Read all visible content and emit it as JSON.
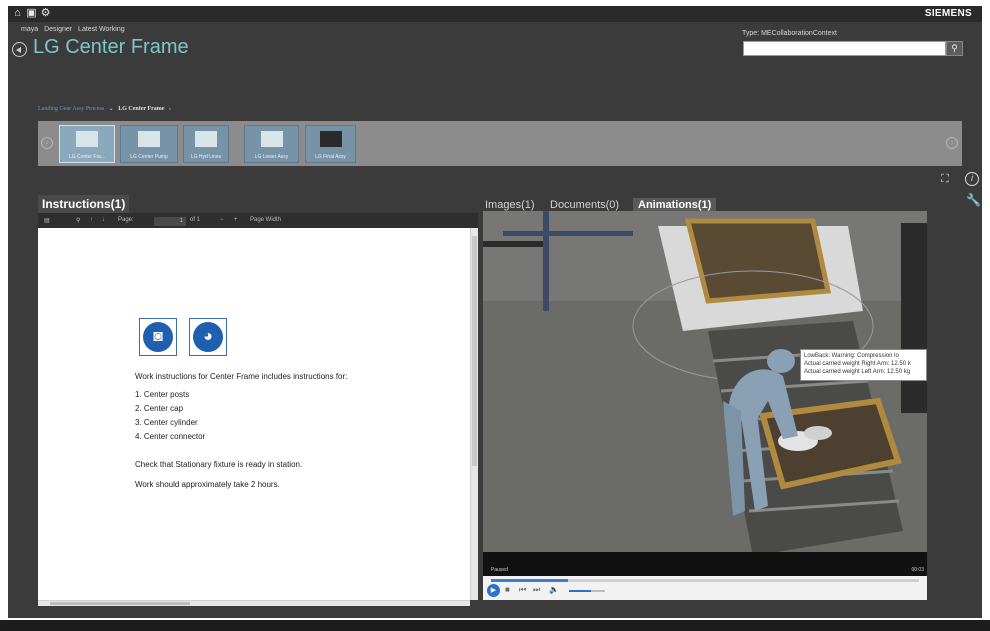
{
  "topbar": {
    "icons": [
      "home-icon",
      "export-icon",
      "settings-icon"
    ],
    "brand": "SIEMENS"
  },
  "header": {
    "crumbs": [
      "maya",
      "Designer",
      "Latest Working"
    ],
    "title": "LG Center Frame",
    "type_label": "Type: MECollaborationContext",
    "search_value": ""
  },
  "process": {
    "parent": "Landing Gear Assy Process",
    "current": "LG Center Frame"
  },
  "carousel": {
    "items": [
      {
        "label": "LG Center Fra...",
        "active": true
      },
      {
        "label": "LG Center Pump",
        "active": false
      },
      {
        "label": "LG Hyd Lines",
        "active": false
      },
      {
        "label": "LG Lower Assy",
        "active": false
      },
      {
        "label": "LG Final Assy",
        "active": false
      }
    ]
  },
  "instructions": {
    "title": "Instructions(1)",
    "toolbar": {
      "page_label": "Page:",
      "page_value": "1",
      "page_of": "of 1",
      "zoom": "Page Width"
    },
    "heading": "Work instructions for Center Frame includes instructions for:",
    "items": [
      "1.  Center posts",
      "2.  Center cap",
      "3.  Center cylinder",
      "4.  Center connector"
    ],
    "note1": "Check that Stationary fixture is ready in station.",
    "note2": "Work should approximately take 2 hours."
  },
  "media": {
    "tabs": [
      "Images(1)",
      "Documents(0)",
      "Animations(1)"
    ],
    "active_tab": "Animations(1)",
    "tooltip": [
      "LowBack:  Warning: Compression lo",
      "Actual carried weight Right Arm: 12.50 k",
      "Actual carried weight Left Arm: 12.50 kg"
    ],
    "status": "Paused",
    "time": "00:03",
    "progress_fraction": 0.18,
    "volume_fraction": 0.6
  }
}
